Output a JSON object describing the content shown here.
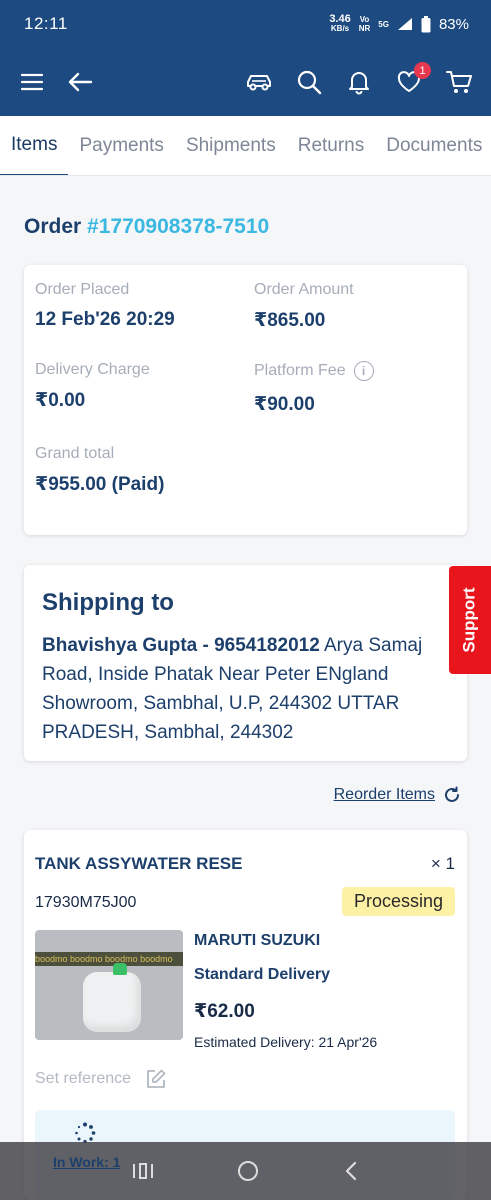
{
  "status_bar": {
    "time": "12:11",
    "net_speed_value": "3.46",
    "net_speed_unit": "KB/s",
    "volte": "Vo",
    "volte_sub": "NR",
    "signal_label": "5G",
    "battery": "83%"
  },
  "app_bar": {
    "wishlist_badge": "1"
  },
  "tabs": [
    {
      "label": "Items",
      "active": true
    },
    {
      "label": "Payments",
      "active": false
    },
    {
      "label": "Shipments",
      "active": false
    },
    {
      "label": "Returns",
      "active": false
    },
    {
      "label": "Documents",
      "active": false
    }
  ],
  "order": {
    "prefix": "Order ",
    "number": "#1770908378-7510"
  },
  "summary": {
    "order_placed_label": "Order Placed",
    "order_placed_value": "12 Feb'26 20:29",
    "order_amount_label": "Order Amount",
    "order_amount_value": "₹865.00",
    "delivery_charge_label": "Delivery Charge",
    "delivery_charge_value": "₹0.00",
    "platform_fee_label": "Platform Fee",
    "platform_fee_value": "₹90.00",
    "grand_total_label": "Grand total",
    "grand_total_value": "₹955.00 (Paid)"
  },
  "shipping": {
    "title": "Shipping to",
    "name_phone": "Bhavishya Gupta - 9654182012",
    "address": " Arya Samaj Road, Inside Phatak Near Peter ENgland Showroom, Sambhal, U.P, 244302 UTTAR PRADESH, Sambhal, 244302"
  },
  "support_label": "Support",
  "reorder_label": "Reorder Items",
  "item": {
    "name": "TANK ASSYWATER RESE",
    "qty": "× 1",
    "part_no": "17930M75J00",
    "status": "Processing",
    "thumb_strip_text": "boodmo boodmo boodmo boodmo",
    "brand": "MARUTI SUZUKI",
    "delivery_type": "Standard Delivery",
    "price": "₹62.00",
    "estimated_delivery": "Estimated Delivery: 21 Apr'26",
    "set_reference_label": "Set reference"
  },
  "in_work_label": "In Work: 1",
  "colors": {
    "brand_blue": "#1d4a80",
    "accent_cyan": "#3bb8e2",
    "support_red": "#e8151d",
    "status_yellow": "#fdf1a6"
  },
  "icons": [
    "menu-icon",
    "back-arrow-icon",
    "car-icon",
    "search-icon",
    "bell-icon",
    "heart-icon",
    "cart-icon",
    "info-icon",
    "refresh-icon",
    "edit-icon",
    "spinner-icon"
  ]
}
